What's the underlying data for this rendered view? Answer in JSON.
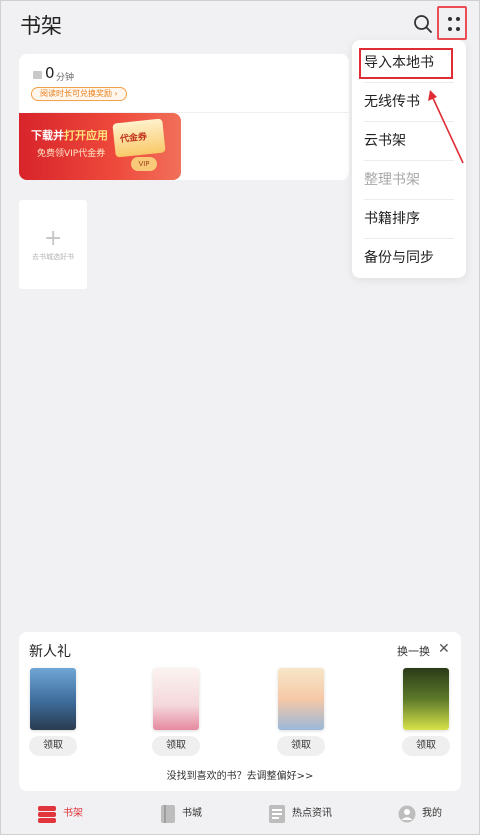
{
  "header": {
    "title": "书架"
  },
  "reading": {
    "minutes": "0",
    "unit": "分钟",
    "exchange_label": "阅读时长可兑换奖励 ›"
  },
  "banner": {
    "main_prefix": "下载并",
    "main_highlight": "打开应用",
    "sub": "免费领VIP代金券",
    "coupon_label": "代金券",
    "coupon_badge": "VIP"
  },
  "add_book": {
    "label": "去书城选好书"
  },
  "menu": {
    "items": [
      {
        "label": "导入本地书"
      },
      {
        "label": "无线传书"
      },
      {
        "label": "云书架"
      },
      {
        "label": "整理书架"
      },
      {
        "label": "书籍排序"
      },
      {
        "label": "备份与同步"
      }
    ]
  },
  "gift": {
    "title": "新人礼",
    "swap": "换一换",
    "close": "✕",
    "claim_label": "领取",
    "footer": "没找到喜欢的书？去调整偏好>>",
    "book_colors": [
      "#3d6b9a",
      "#f4d8dc",
      "#f6c9a8",
      "#5d7a2a"
    ]
  },
  "nav": {
    "items": [
      {
        "label": "书架",
        "icon": "bookshelf-icon"
      },
      {
        "label": "书城",
        "icon": "bookstore-icon"
      },
      {
        "label": "热点资讯",
        "icon": "news-icon"
      },
      {
        "label": "我的",
        "icon": "profile-icon"
      }
    ],
    "active_color": "#e1343c"
  }
}
